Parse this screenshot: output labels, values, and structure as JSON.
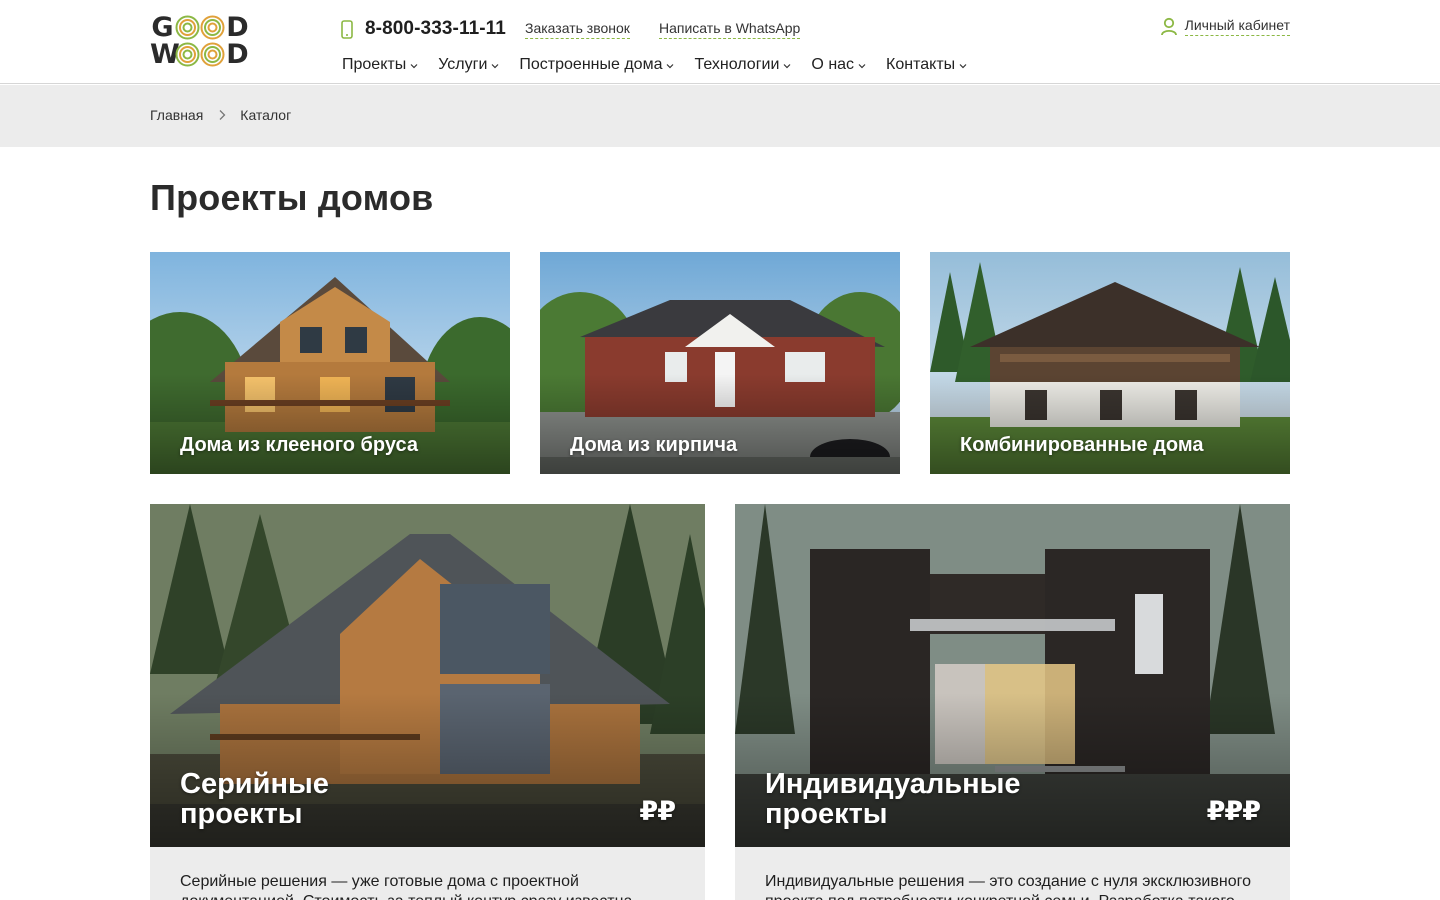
{
  "header": {
    "logo_top": [
      "G",
      "D"
    ],
    "logo_bottom": [
      "W",
      "D"
    ],
    "phone": "8-800-333-11-11",
    "callback_label": "Заказать звонок",
    "whatsapp_label": "Написать в WhatsApp",
    "account_label": "Личный кабинет",
    "accent_color": "#8cb844",
    "nav": [
      {
        "label": "Проекты"
      },
      {
        "label": "Услуги"
      },
      {
        "label": "Построенные дома"
      },
      {
        "label": "Технологии"
      },
      {
        "label": "О нас"
      },
      {
        "label": "Контакты"
      }
    ]
  },
  "breadcrumb": {
    "items": [
      "Главная",
      "Каталог"
    ]
  },
  "page_title": "Проекты домов",
  "categories": [
    {
      "title": "Дома из клееного бруса",
      "image_icon": "timber-house-photo"
    },
    {
      "title": "Дома из кирпича",
      "image_icon": "brick-house-photo"
    },
    {
      "title": "Комбинированные дома",
      "image_icon": "combined-house-photo"
    }
  ],
  "offers": [
    {
      "title_line1": "Серийные",
      "title_line2": "проекты",
      "price": "₽₽",
      "description": "Серийные решения — уже готовые дома с проектной документацией. Стоимость за теплый контур сразу известна",
      "image_icon": "log-house-photo"
    },
    {
      "title_line1": "Индивидуальные",
      "title_line2": "проекты",
      "price": "₽₽₽",
      "description": "Индивидуальные решения — это создание с нуля эксклюзивного проекта под потребности конкретной семьи. Разработка такого",
      "image_icon": "modern-house-photo"
    }
  ]
}
